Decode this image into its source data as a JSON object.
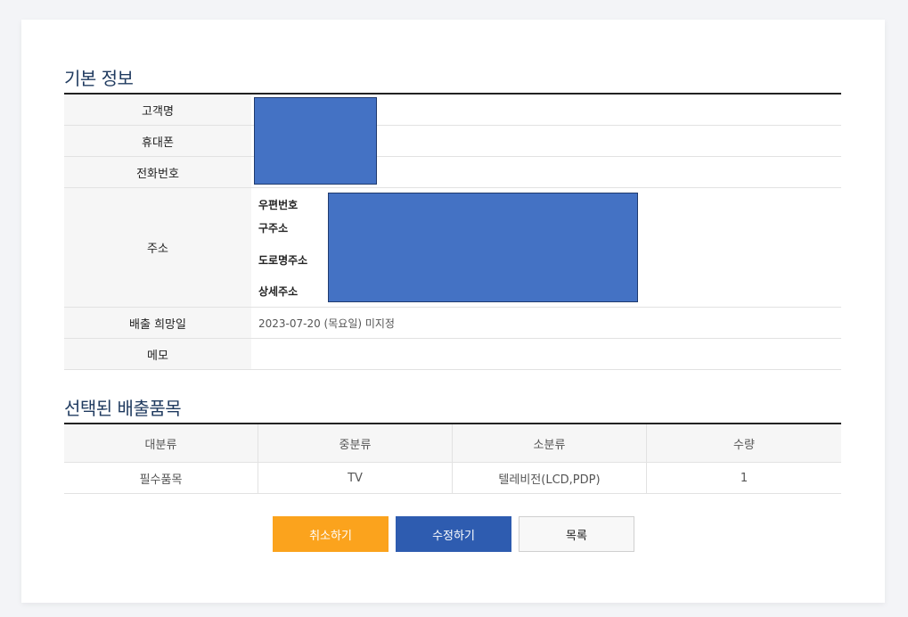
{
  "basic_info": {
    "title": "기본 정보",
    "rows": {
      "customer_name_label": "고객명",
      "mobile_label": "휴대폰",
      "phone_label": "전화번호",
      "address_label": "주소",
      "address_sub": {
        "postal": "우편번호",
        "old_address": "구주소",
        "road_address": "도로명주소",
        "detail_address": "상세주소"
      },
      "pickup_date_label": "배출 희망일",
      "pickup_date_value": "2023-07-20 (목요일) 미지정",
      "memo_label": "메모",
      "memo_value": ""
    }
  },
  "selected_items": {
    "title": "선택된 배출품목",
    "headers": [
      "대분류",
      "중분류",
      "소분류",
      "수량"
    ],
    "rows": [
      [
        "필수품목",
        "TV",
        "텔레비전(LCD,PDP)",
        "1"
      ]
    ]
  },
  "buttons": {
    "cancel": "취소하기",
    "edit": "수정하기",
    "list": "목록"
  },
  "colors": {
    "redaction": "#4472c4",
    "cancel_button": "#fba31d",
    "edit_button": "#2e5cb0",
    "title_text": "#1f3a5f"
  }
}
